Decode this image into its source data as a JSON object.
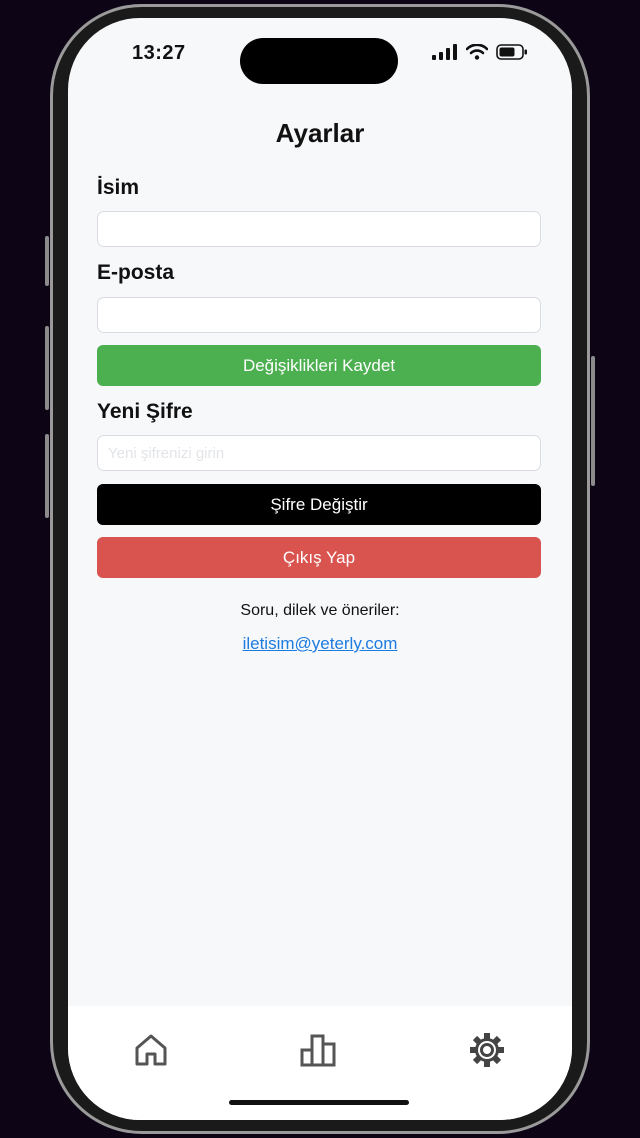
{
  "status_bar": {
    "time": "13:27"
  },
  "header": {
    "title": "Ayarlar"
  },
  "form": {
    "name_label": "İsim",
    "name_value": "",
    "email_label": "E-posta",
    "email_value": "",
    "save_button": "Değişiklikleri Kaydet",
    "new_password_label": "Yeni Şifre",
    "new_password_placeholder": "Yeni şifrenizi girin",
    "change_password_button": "Şifre Değiştir",
    "logout_button": "Çıkış Yap"
  },
  "contact": {
    "text": "Soru, dilek ve öneriler:",
    "email": "iletisim@yeterly.com"
  },
  "tabbar": {
    "items": [
      {
        "icon": "home-icon"
      },
      {
        "icon": "stats-icon"
      },
      {
        "icon": "settings-icon",
        "active": true
      }
    ]
  },
  "colors": {
    "save": "#4caf50",
    "change_password": "#000000",
    "logout": "#d9534f",
    "link": "#1e7be0"
  }
}
